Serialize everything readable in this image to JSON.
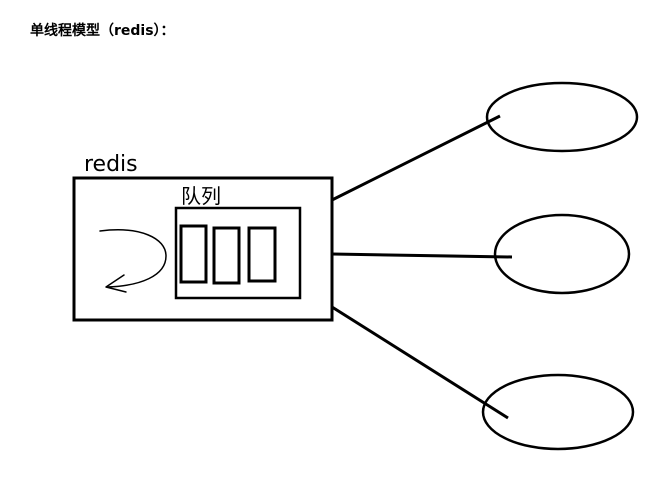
{
  "heading": "单线程模型（redis）：",
  "diagram": {
    "server_label": "redis",
    "queue_label": "队列",
    "queue_slot_count": 3,
    "client_count": 3,
    "stroke_color": "#000000"
  }
}
